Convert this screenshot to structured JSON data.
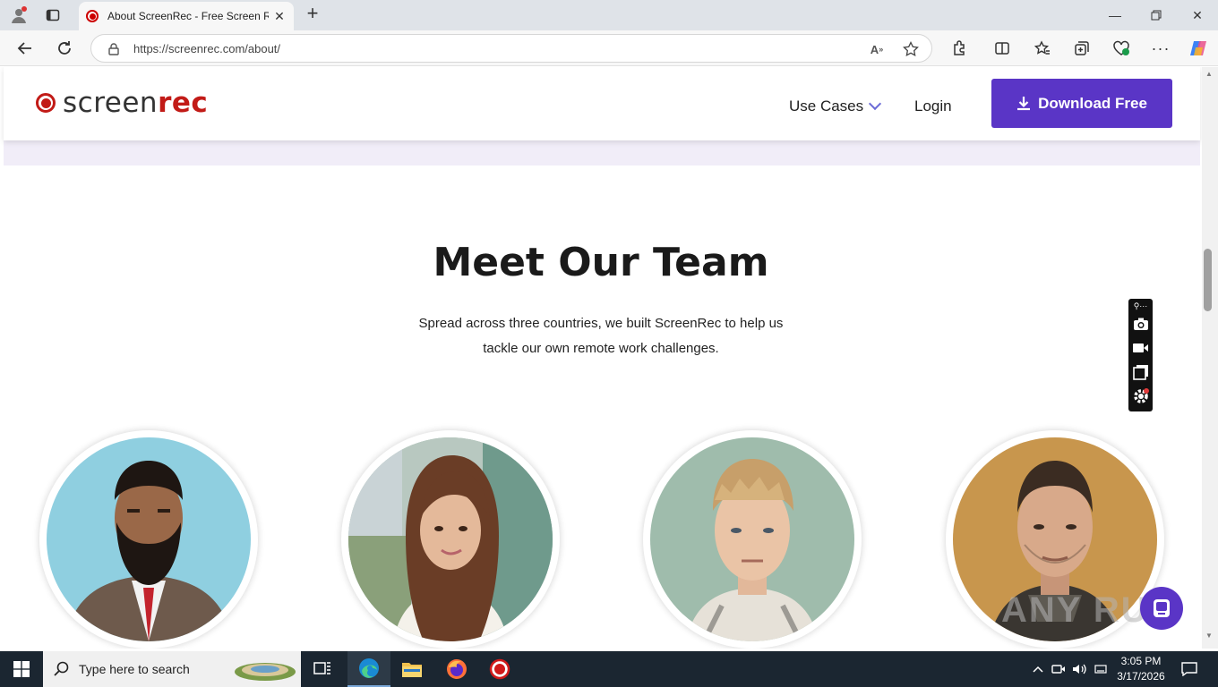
{
  "browser": {
    "tab_title": "About ScreenRec - Free Screen Re",
    "url": "https://screenrec.com/about/",
    "new_tab_symbol": "+"
  },
  "site": {
    "logo_part1": "screen",
    "logo_part2": "rec",
    "nav_use_cases": "Use Cases",
    "nav_login": "Login",
    "download_button": "Download Free",
    "brand_color": "#5a35c6",
    "logo_color": "#c21b17"
  },
  "team": {
    "heading": "Meet Our Team",
    "subtitle_line1": "Spread across three countries, we built ScreenRec to help us",
    "subtitle_line2": "tackle our own remote work challenges.",
    "members": [
      {
        "portrait": "bearded-man-portrait",
        "bg": "#8fcfe0"
      },
      {
        "portrait": "woman-portrait",
        "bg": "#9bb7a8"
      },
      {
        "portrait": "young-man-portrait",
        "bg": "#9fbcac"
      },
      {
        "portrait": "man-portrait",
        "bg": "#c8964d"
      }
    ]
  },
  "watermark": "ANY RUN",
  "taskbar": {
    "search_placeholder": "Type here to search",
    "time": "3:05 PM",
    "date": "3/17/2026"
  }
}
